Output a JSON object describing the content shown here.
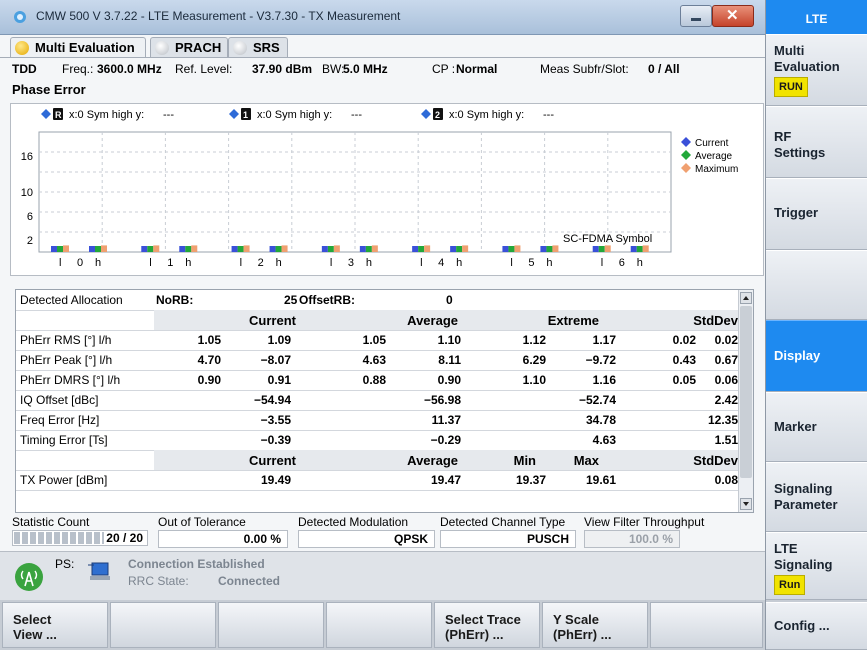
{
  "window": {
    "title": "CMW 500 V 3.7.22 - LTE Measurement  - V3.7.30 - TX Measurement"
  },
  "tabs": [
    {
      "label": "Multi Evaluation",
      "color": "#f5c518",
      "active": true
    },
    {
      "label": "PRACH",
      "color": "#c8ccd2",
      "active": false
    },
    {
      "label": "SRS",
      "color": "#c8ccd2",
      "active": false
    }
  ],
  "info": {
    "duplex": "TDD",
    "freq_label": "Freq.:",
    "freq_value": "3600.0 MHz",
    "ref_label": "Ref. Level:",
    "ref_value": "37.90 dBm",
    "bw_label": "BW:",
    "bw_value": "5.0 MHz",
    "cp_label": "CP :",
    "cp_value": "Normal",
    "meas_label": "Meas Subfr/Slot:",
    "meas_value": "0  / All",
    "section": "Phase Error"
  },
  "chart_data": {
    "type": "bar",
    "yticks": [
      "2",
      "6",
      "10",
      "16"
    ],
    "ylim": [
      0,
      20
    ],
    "x_groups": [
      "0",
      "1",
      "2",
      "3",
      "4",
      "5",
      "6"
    ],
    "x_prefix": "l",
    "x_suffix": "h",
    "x_annotation": "SC-FDMA Symbol",
    "markers": [
      {
        "id": "R",
        "text": "x:0 Sym high  y:",
        "value": "---"
      },
      {
        "id": "1",
        "text": "x:0 Sym high  y:",
        "value": "---"
      },
      {
        "id": "2",
        "text": "x:0 Sym high  y:",
        "value": "---"
      }
    ],
    "legend": [
      {
        "name": "Current",
        "color": "#3a50d9"
      },
      {
        "name": "Average",
        "color": "#22a83a"
      },
      {
        "name": "Maximum",
        "color": "#f0a070"
      }
    ],
    "series": [
      {
        "name": "Current",
        "values": [
          1.0,
          1.0,
          1.0,
          1.0,
          1.0,
          1.0,
          1.0,
          1.0,
          1.0,
          1.0,
          1.0,
          1.0,
          1.0,
          1.0
        ]
      },
      {
        "name": "Average",
        "values": [
          1.0,
          1.0,
          1.0,
          1.0,
          1.0,
          1.0,
          1.0,
          1.0,
          1.0,
          1.0,
          1.0,
          1.0,
          1.0,
          1.0
        ]
      },
      {
        "name": "Maximum",
        "values": [
          1.1,
          1.1,
          1.1,
          1.1,
          1.1,
          1.1,
          1.1,
          1.1,
          1.1,
          1.1,
          1.1,
          1.1,
          1.1,
          1.1
        ]
      }
    ]
  },
  "table": {
    "alloc_label": "Detected Allocation",
    "norb_label": "NoRB:",
    "norb_value": "25",
    "offsetrb_label": "OffsetRB:",
    "offsetrb_value": "0",
    "header1": [
      "Current",
      "Average",
      "Extreme",
      "StdDev"
    ],
    "rows": [
      {
        "label": "PhErr RMS [°] l/h",
        "cells": [
          "1.05",
          "1.09",
          "1.05",
          "1.10",
          "1.12",
          "1.17",
          "0.02",
          "0.02"
        ]
      },
      {
        "label": "PhErr Peak [°] l/h",
        "cells": [
          "4.70",
          "−8.07",
          "4.63",
          "8.11",
          "6.29",
          "−9.72",
          "0.43",
          "0.67"
        ]
      },
      {
        "label": "PhErr DMRS [°] l/h",
        "cells": [
          "0.90",
          "0.91",
          "0.88",
          "0.90",
          "1.10",
          "1.16",
          "0.05",
          "0.06"
        ]
      },
      {
        "label": "IQ Offset [dBc]",
        "cells": [
          "",
          "−54.94",
          "",
          "−56.98",
          "",
          "−52.74",
          "",
          "2.42"
        ]
      },
      {
        "label": "Freq Error [Hz]",
        "cells": [
          "",
          "−3.55",
          "",
          "11.37",
          "",
          "34.78",
          "",
          "12.35"
        ]
      },
      {
        "label": "Timing Error [Ts]",
        "cells": [
          "",
          "−0.39",
          "",
          "−0.29",
          "",
          "4.63",
          "",
          "1.51"
        ]
      }
    ],
    "header2": [
      "Current",
      "Average",
      "Min",
      "Max",
      "StdDev"
    ],
    "power_rows": [
      {
        "label": "TX Power [dBm]",
        "cells": [
          "19.49",
          "19.47",
          "19.37",
          "19.61",
          "0.08"
        ]
      }
    ]
  },
  "stats": {
    "count_label": "Statistic Count",
    "count_value": "20 / 20",
    "count_progress": 1.0,
    "oot_label": "Out of Tolerance",
    "oot_value": "0.00  %",
    "mod_label": "Detected Modulation",
    "mod_value": "QPSK",
    "chtype_label": "Detected Channel Type",
    "chtype_value": "PUSCH",
    "vft_label": "View Filter Throughput",
    "vft_value": "100.0  %"
  },
  "connection": {
    "ps_label": "PS:",
    "status": "Connection Established",
    "rrc_label": "RRC State:",
    "rrc_value": "Connected"
  },
  "bottom_softkeys": [
    {
      "line1": "Select",
      "line2": "View ..."
    },
    {
      "line1": "",
      "line2": ""
    },
    {
      "line1": "",
      "line2": ""
    },
    {
      "line1": "",
      "line2": ""
    },
    {
      "line1": "Select Trace",
      "line2": "(PhErr) ..."
    },
    {
      "line1": "Y Scale",
      "line2": "(PhErr) ..."
    },
    {
      "line1": "",
      "line2": ""
    }
  ],
  "sidebar": {
    "header": "LTE",
    "multi_eval_line1": "Multi",
    "multi_eval_line2": "Evaluation",
    "multi_eval_badge": "RUN",
    "rf_line1": "RF",
    "rf_line2": "Settings",
    "trigger": "Trigger",
    "display": "Display",
    "marker": "Marker",
    "sig_line1": "Signaling",
    "sig_line2": "Parameter",
    "lte_line1": "LTE",
    "lte_line2": "Signaling",
    "lte_badge": "Run",
    "config": "Config ..."
  },
  "colors": {
    "sidebar_active": "#1e8af0",
    "title_blue": "#1b6fd6"
  }
}
